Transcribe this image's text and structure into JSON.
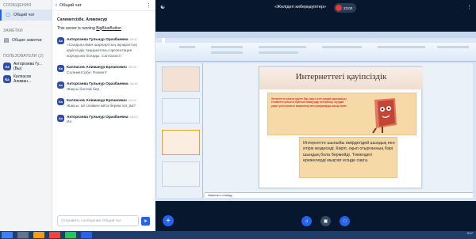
{
  "nav": {
    "section_messages": "СООБЩЕНИЯ",
    "public_chat": "Общий чат",
    "section_notes": "ЗАМЕТКИ",
    "shared_notes": "Общие заметки",
    "section_users": "ПОЛЬЗОВАТЕЛИ (2)",
    "users": [
      {
        "initials": "Ак",
        "name": "Акторгаева Гу... (Вы)"
      },
      {
        "initials": "Ка",
        "name": "Калпасов Алиман..."
      }
    ]
  },
  "chat": {
    "title": "Общий чат",
    "welcome_greeting": "Сәлеметсізбе. Аликонсур",
    "welcome_text_prefix": "This server is running ",
    "welcome_link": "BigBlueButton",
    "messages": [
      {
        "initials": "Ак",
        "name": "Акторгаева Гульнур Оразбаевна",
        "time": "08:47",
        "text": "«Сандық ілімін шарнарттың ақпараттық қауіпсіздік тақырыптағы презентация корғауына болады. Сапталасті"
      },
      {
        "initials": "Ка",
        "name": "Калпасов Алиманур Ерланович",
        "time": "08:48",
        "text": "Сәлеметсізбе. Рахмет!"
      },
      {
        "initials": "Ак",
        "name": "Акторгаева Гульнур Оразбаевна",
        "time": "08:48",
        "text": "Жақсы бастай бер"
      },
      {
        "initials": "Ка",
        "name": "Калпасов Алиманур Ерланович",
        "time": "08:53",
        "text": "Жақсы. ал сөзімен айта берем ілл_ва?"
      },
      {
        "initials": "Ак",
        "name": "Акторгаева Гульнур Оразбаевна",
        "time": "08:53",
        "text": "Иә"
      }
    ],
    "input_placeholder": "Отправить сообщение Общий чат"
  },
  "topbar": {
    "title": "«Желідегі киберқауіптер»",
    "rec_time": "23:00"
  },
  "slide": {
    "title": "Интернеттегі қауіпсіздік",
    "small_text": "Интернетте желілік қауіпті бар уақыт сізге қандай қамтамасыз етілмегені қатысты бірнеше мазмұндар келтіріледі. Мұндай уақыт үшін қатысты мақалалар мен қағидаларды жасау керек.",
    "big_text": "Интернетте шыныйы өмірдегідей шындық пен өтірік кездеседі. Көріп, оқып отырғанның бәрі шындық бола бермейді. Төмендегі ережелерді мықтап есіңде сақта.",
    "notes": "Заметки к слайду"
  },
  "taskbar": {
    "clock": "9:17"
  }
}
